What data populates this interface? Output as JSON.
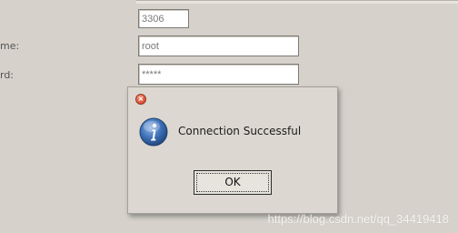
{
  "form": {
    "port_value": "3306",
    "username_label": "me:",
    "username_value": "root",
    "password_label": "rd:",
    "password_value": "*****"
  },
  "dialog": {
    "icon": "info-icon",
    "message": "Connection Successful",
    "ok_label": "OK",
    "close_glyph": "×"
  },
  "watermark": "https://blog.csdn.net/qq_34419418",
  "colors": {
    "background": "#d6d2cb",
    "dialog_bg": "#dcd8d1",
    "close_button": "#e35b3f",
    "info_icon": "#3b6fb6"
  }
}
